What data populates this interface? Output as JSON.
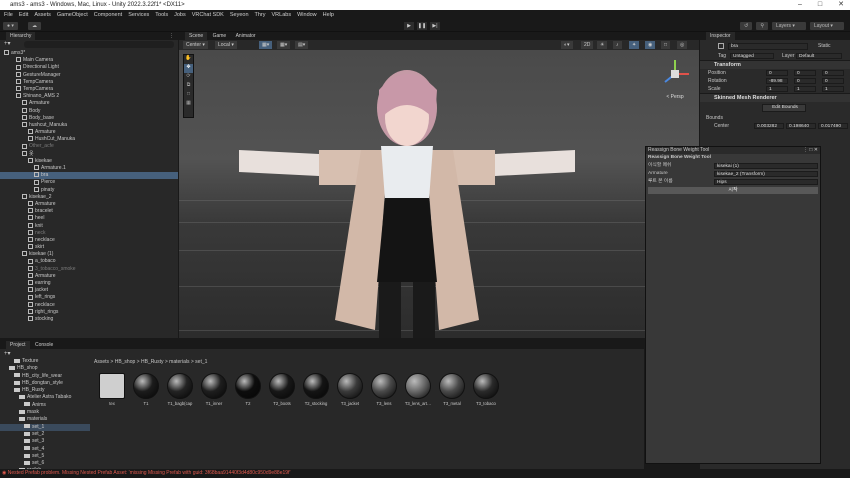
{
  "window": {
    "title": "ams3 - ams3 - Windows, Mac, Linux - Unity 2022.3.22f1* <DX11>"
  },
  "menu": [
    "File",
    "Edit",
    "Assets",
    "GameObject",
    "Component",
    "Services",
    "Tools",
    "Jobs",
    "VRChat SDK",
    "Seyeon",
    "Thry",
    "VRLabs",
    "Window",
    "Help"
  ],
  "toolbar": {
    "layers": "Layers",
    "layout": "Layout"
  },
  "hierarchy": {
    "tab": "Hierarchy",
    "rows": [
      {
        "label": "ams3*",
        "indent": 0,
        "dim": false,
        "sel": false
      },
      {
        "label": "Main Camera",
        "indent": 2,
        "dim": false,
        "sel": false
      },
      {
        "label": "Directional Light",
        "indent": 2,
        "dim": false,
        "sel": false
      },
      {
        "label": "GestureManager",
        "indent": 2,
        "dim": false,
        "sel": false
      },
      {
        "label": "TempCamera",
        "indent": 2,
        "dim": false,
        "sel": false
      },
      {
        "label": "TempCamera",
        "indent": 2,
        "dim": false,
        "sel": false
      },
      {
        "label": "Shinano_AMS 2",
        "indent": 2,
        "dim": false,
        "sel": false
      },
      {
        "label": "Armature",
        "indent": 3,
        "dim": false,
        "sel": false
      },
      {
        "label": "Body",
        "indent": 3,
        "dim": false,
        "sel": false
      },
      {
        "label": "Body_base",
        "indent": 3,
        "dim": false,
        "sel": false
      },
      {
        "label": "hushcut_Manuka",
        "indent": 3,
        "dim": false,
        "sel": false
      },
      {
        "label": "Armature",
        "indent": 4,
        "dim": false,
        "sel": false
      },
      {
        "label": "HushCut_Manuka",
        "indent": 4,
        "dim": false,
        "sel": false
      },
      {
        "label": "Other_acfe",
        "indent": 3,
        "dim": true,
        "sel": false
      },
      {
        "label": "옷",
        "indent": 3,
        "dim": false,
        "sel": false
      },
      {
        "label": "kisekae",
        "indent": 4,
        "dim": false,
        "sel": false
      },
      {
        "label": "Armature.1",
        "indent": 5,
        "dim": false,
        "sel": false
      },
      {
        "label": "bra",
        "indent": 5,
        "dim": false,
        "sel": true
      },
      {
        "label": "Pierce",
        "indent": 5,
        "dim": false,
        "sel": false
      },
      {
        "label": "pinaty",
        "indent": 5,
        "dim": false,
        "sel": false
      },
      {
        "label": "kisekae_2",
        "indent": 3,
        "dim": false,
        "sel": false
      },
      {
        "label": "Armature",
        "indent": 4,
        "dim": false,
        "sel": false
      },
      {
        "label": "bracelet",
        "indent": 4,
        "dim": false,
        "sel": false
      },
      {
        "label": "heel",
        "indent": 4,
        "dim": false,
        "sel": false
      },
      {
        "label": "knit",
        "indent": 4,
        "dim": false,
        "sel": false
      },
      {
        "label": "neck",
        "indent": 4,
        "dim": true,
        "sel": false
      },
      {
        "label": "necklace",
        "indent": 4,
        "dim": false,
        "sel": false
      },
      {
        "label": "skirt",
        "indent": 4,
        "dim": false,
        "sel": false
      },
      {
        "label": "kisekae (1)",
        "indent": 3,
        "dim": false,
        "sel": false
      },
      {
        "label": "a_tobaco",
        "indent": 4,
        "dim": false,
        "sel": false
      },
      {
        "label": "3_tobacco_smoke",
        "indent": 4,
        "dim": true,
        "sel": false
      },
      {
        "label": "Armature",
        "indent": 4,
        "dim": false,
        "sel": false
      },
      {
        "label": "earring",
        "indent": 4,
        "dim": false,
        "sel": false
      },
      {
        "label": "jacket",
        "indent": 4,
        "dim": false,
        "sel": false
      },
      {
        "label": "left_rings",
        "indent": 4,
        "dim": false,
        "sel": false
      },
      {
        "label": "necklace",
        "indent": 4,
        "dim": false,
        "sel": false
      },
      {
        "label": "right_rings",
        "indent": 4,
        "dim": false,
        "sel": false
      },
      {
        "label": "stocking",
        "indent": 4,
        "dim": false,
        "sel": false
      }
    ]
  },
  "scene": {
    "tabs": [
      "Scene",
      "Game",
      "Animator"
    ],
    "center": "Center",
    "local": "Local",
    "persp": "< Persp"
  },
  "inspector": {
    "tab": "Inspector",
    "object_name": "bra",
    "static": "Static",
    "tag_label": "Tag",
    "tag_value": "Untagged",
    "layer_label": "Layer",
    "layer_value": "Default",
    "transform_title": "Transform",
    "position_label": "Position",
    "position": {
      "x": "0",
      "y": "0",
      "z": "0"
    },
    "rotation_label": "Rotation",
    "rotation": {
      "x": "-89.98",
      "y": "0",
      "z": "0"
    },
    "scale_label": "Scale",
    "scale": {
      "x": "1",
      "y": "1",
      "z": "1"
    },
    "smr_title": "Skinned Mesh Renderer",
    "edit_bounds": "Edit Bounds",
    "bounds_label": "Bounds",
    "center_label": "Center",
    "center": {
      "x": "0.003282",
      "y": "0.198640",
      "z": "0.017490"
    }
  },
  "tool": {
    "window_title": "Reassign Bone Weight Tool",
    "header": "Reassign Bone Weight Tool",
    "row1_label": "이식할 메쉬",
    "row1_value": "kisekai (1)",
    "row2_label": "Armature",
    "row2_value": "kisekae_2 (Transform)",
    "row3_label": "루트 본 이름",
    "row3_value": "Hips",
    "button": "시작"
  },
  "project": {
    "tabs": [
      "Project",
      "Console"
    ],
    "breadcrumb": "Assets > HB_shop > HB_Rusty > materials > set_1",
    "folders": [
      "Texture",
      "HB_shop",
      "HB_city_life_wear",
      "HB_dongtan_style",
      "HB_Rusty",
      "Atelier Astra Tabako",
      "Anims",
      "mask",
      "materials",
      "set_1",
      "set_2",
      "set_3",
      "set_4",
      "set_5",
      "set_6",
      "prefab"
    ],
    "assets": [
      "tex",
      "T1",
      "T1_bagb(cap",
      "T1_inner",
      "T2",
      "T2_boots",
      "T2_stocking",
      "T3_jacket",
      "T3_lens",
      "T3_lens_art…",
      "T3_metal",
      "T3_tobaco"
    ],
    "badge": "25"
  },
  "status": {
    "error": "Nested Prefab problem. Missing Nested Prefab Asset: 'missing Missing Prefab with guid: 3f68baa91440f3d4d80c950d9e88e19f'"
  },
  "colors": {
    "accent": "#46607c",
    "error": "#e05a4e"
  }
}
